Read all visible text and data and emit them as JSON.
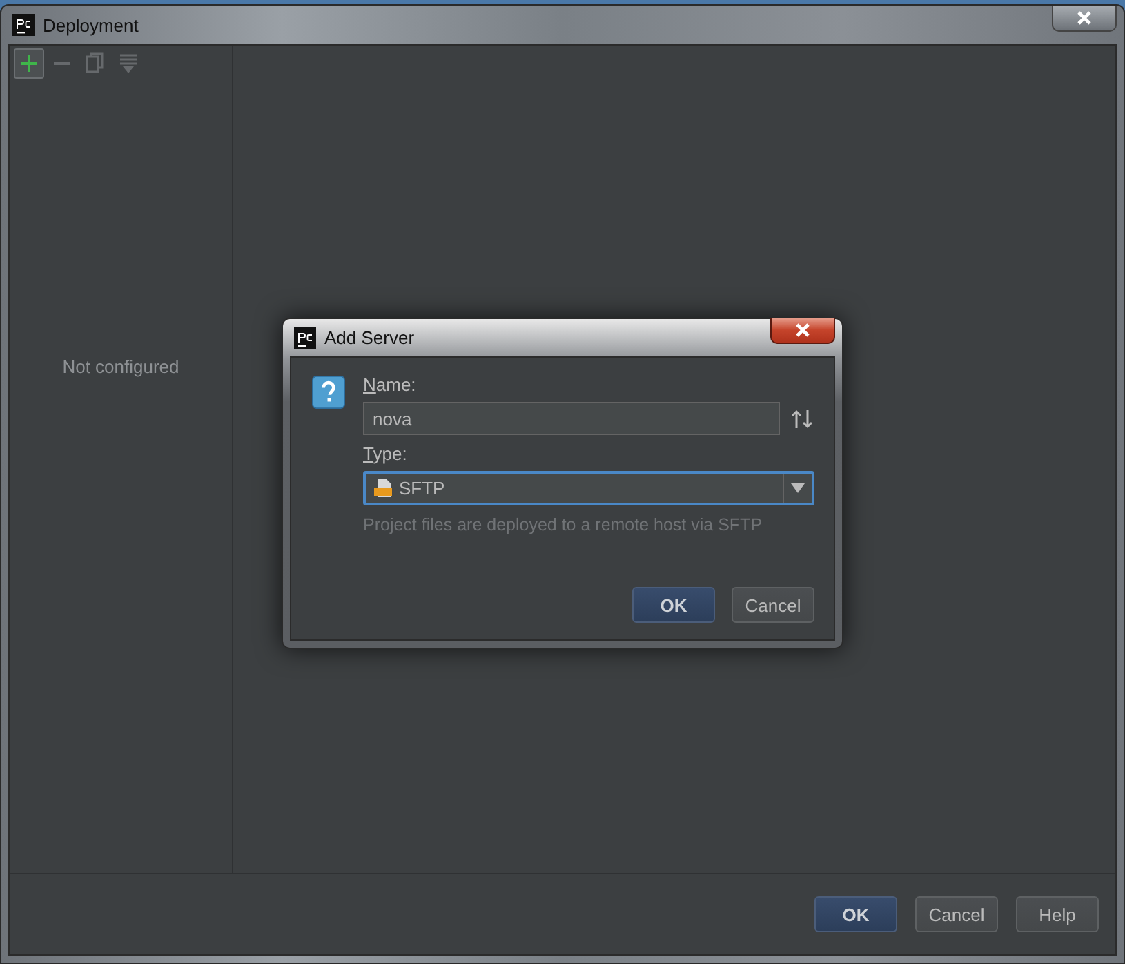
{
  "window": {
    "title": "Deployment",
    "toolbar": [
      {
        "kind": "add",
        "disabled": false,
        "hovered": true
      },
      {
        "kind": "remove",
        "disabled": true,
        "hovered": false
      },
      {
        "kind": "copy",
        "disabled": true,
        "hovered": false
      },
      {
        "kind": "move",
        "disabled": true,
        "hovered": false
      }
    ],
    "sidebar": {
      "empty_text": "Not configured"
    },
    "buttons": [
      {
        "label": "OK",
        "default": true
      },
      {
        "label": "Cancel",
        "default": false
      },
      {
        "label": "Help",
        "default": false
      }
    ]
  },
  "dialog": {
    "title": "Add Server",
    "name": {
      "label": "Name:",
      "value": "nova"
    },
    "type": {
      "label": "Type:",
      "value": "SFTP",
      "focused": true
    },
    "description": "Project files are deployed to a remote host via SFTP",
    "buttons": [
      {
        "label": "OK",
        "default": true
      },
      {
        "label": "Cancel",
        "default": false
      }
    ]
  }
}
